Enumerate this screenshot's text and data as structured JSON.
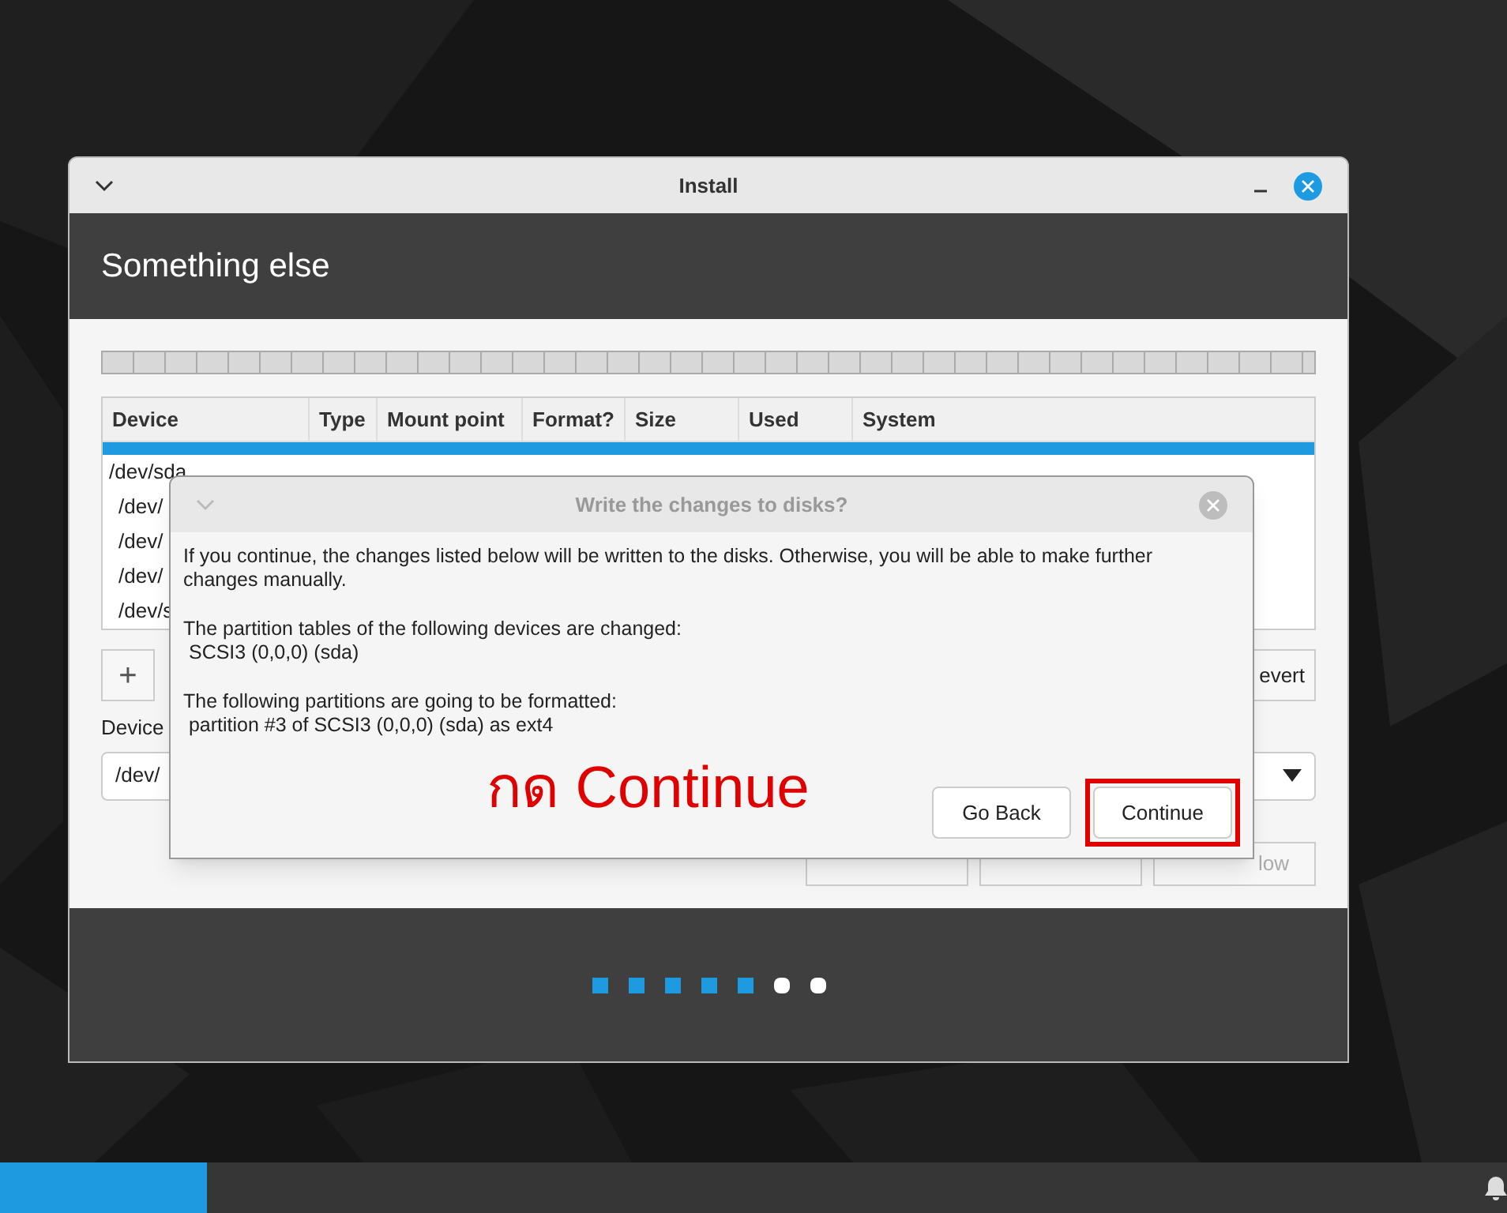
{
  "window": {
    "title": "Install",
    "heading": "Something else"
  },
  "table": {
    "columns": [
      "Device",
      "Type",
      "Mount point",
      "Format?",
      "Size",
      "Used",
      "System"
    ],
    "rows": [
      {
        "device": "",
        "selected": true
      },
      {
        "device": "/dev/sda",
        "selected": false
      },
      {
        "device": "/dev/",
        "selected": false
      },
      {
        "device": "/dev/",
        "selected": false
      },
      {
        "device": "/dev/",
        "selected": false
      },
      {
        "device": "/dev/s",
        "selected": false
      }
    ]
  },
  "add_button": "+",
  "revert_button": "evert",
  "boot_loader": {
    "label": "Device",
    "value": "/dev/"
  },
  "bottom_buttons": [
    {
      "kind": "covered"
    },
    {
      "kind": "covered"
    },
    {
      "kind": "labeled",
      "label": "low"
    }
  ],
  "dialog": {
    "title": "Write the changes to disks?",
    "paragraphs": [
      {
        "lines": [
          "If you continue, the changes listed below will be written to the disks. Otherwise, you will be able to make further changes manually."
        ]
      },
      {
        "lines": [
          "The partition tables of the following devices are changed:",
          " SCSI3 (0,0,0) (sda)"
        ]
      },
      {
        "lines": [
          "The following partitions are going to be formatted:",
          " partition #3 of SCSI3 (0,0,0) (sda) as ext4"
        ]
      }
    ],
    "buttons": [
      {
        "label": "Go Back",
        "highlighted": false
      },
      {
        "label": "Continue",
        "highlighted": true
      }
    ]
  },
  "annotation": "กด Continue",
  "steps": [
    {
      "done": true
    },
    {
      "done": true
    },
    {
      "done": true
    },
    {
      "done": true
    },
    {
      "done": true
    },
    {
      "done": false
    },
    {
      "done": false
    }
  ]
}
